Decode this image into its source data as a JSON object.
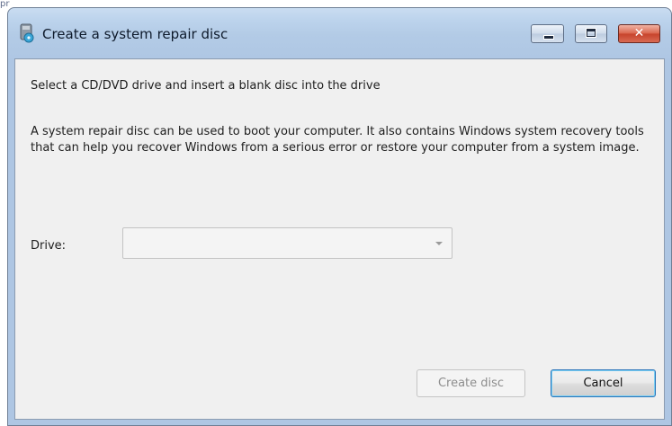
{
  "background": {
    "fragment_text": "pr"
  },
  "window": {
    "title": "Create a system repair disc",
    "icon": "repair-disc-icon",
    "controls": {
      "minimize": "minimize-icon",
      "maximize": "maximize-icon",
      "close": "close-icon",
      "close_glyph": "✕"
    }
  },
  "content": {
    "heading": "Select a CD/DVD drive and insert a blank disc into the drive",
    "description": "A system repair disc can be used to boot your computer. It also contains Windows system recovery tools that can help you recover Windows from a serious error or restore your computer from a system image.",
    "drive": {
      "label": "Drive:",
      "selected_value": "",
      "arrow_icon": "chevron-down-icon",
      "disabled": true
    }
  },
  "buttons": {
    "create_disc": "Create disc",
    "create_disc_disabled": true,
    "cancel": "Cancel"
  },
  "colors": {
    "frame": "#b3cbe6",
    "close_button": "#c6422b",
    "client_background": "#f0f0f0",
    "default_button_border": "#2b74b8"
  }
}
